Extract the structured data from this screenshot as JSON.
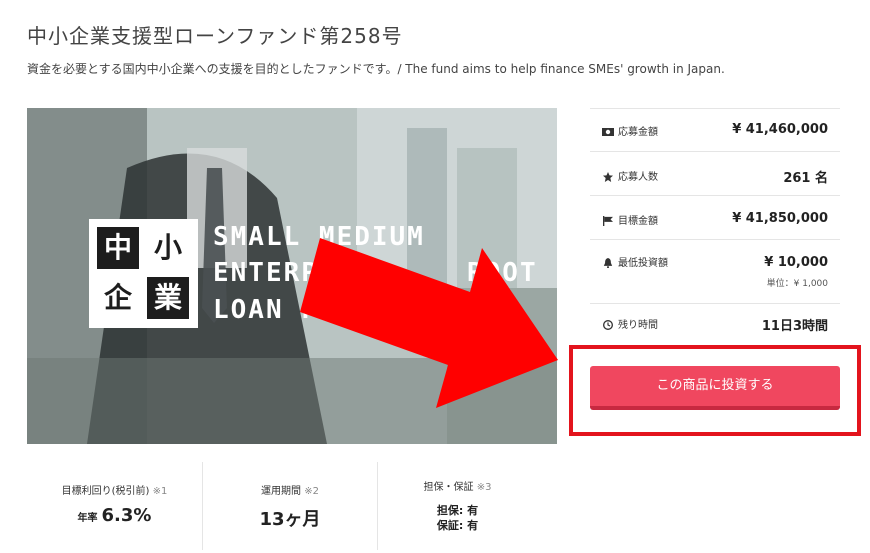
{
  "fund": {
    "title": "中小企業支援型ローンファンド第258号",
    "subtitle": "資金を必要とする国内中小企業への支援を目的としたファンドです。/ The fund aims to help finance SMEs' growth in Japan."
  },
  "hero": {
    "kanji": [
      "中",
      "小",
      "企",
      "業"
    ],
    "lines": [
      "SMALL MEDIUM",
      "ENTERPR",
      "LOAN FU"
    ],
    "lines_right": [
      "ROOT"
    ]
  },
  "info": {
    "rows": [
      {
        "icon": "money-icon",
        "label": "応募金額",
        "value": "¥ 41,460,000"
      },
      {
        "icon": "star-icon",
        "label": "応募人数",
        "value": "261 名"
      },
      {
        "icon": "flag-icon",
        "label": "目標金額",
        "value": "¥ 41,850,000"
      },
      {
        "icon": "bell-icon",
        "label": "最低投資額",
        "value": "¥ 10,000",
        "sub": "単位：¥ 1,000"
      },
      {
        "icon": "clock-icon",
        "label": "残り時間",
        "value": "11日3時間"
      }
    ],
    "cta": "この商品に投資する"
  },
  "stats": {
    "yield_label": "目標利回り(税引前)",
    "yield_note": "※1",
    "yield_prefix": "年率",
    "yield_value": "6.3%",
    "period_label": "運用期間",
    "period_note": "※2",
    "period_value": "13ヶ月",
    "collateral_label": "担保・保証",
    "collateral_note": "※3",
    "collateral_line1": "担保: 有",
    "collateral_line2": "保証: 有"
  },
  "colors": {
    "cta": "#f0475f",
    "highlight": "#e3141d",
    "arrow": "#ff0000"
  }
}
